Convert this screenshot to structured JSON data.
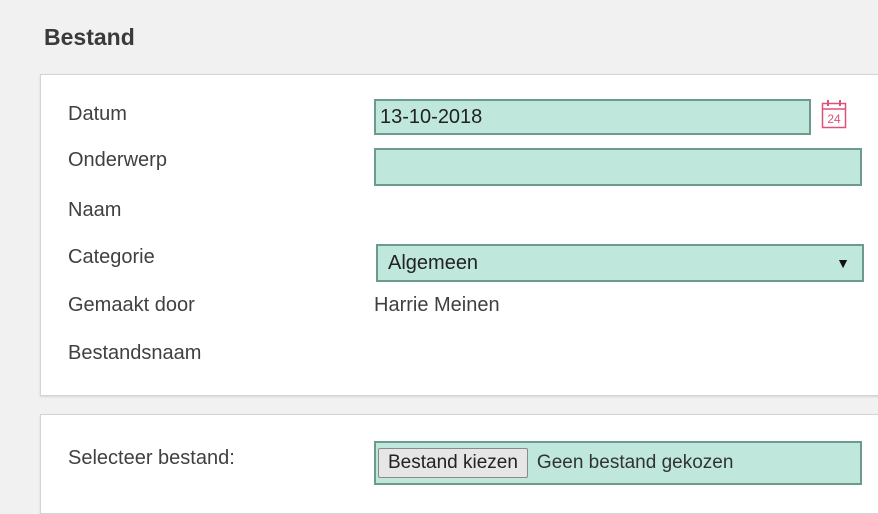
{
  "page": {
    "title": "Bestand"
  },
  "form": {
    "datum_label": "Datum",
    "datum_value": "13-10-2018",
    "calendar_day": "24",
    "onderwerp_label": "Onderwerp",
    "onderwerp_value": "",
    "naam_label": "Naam",
    "categorie_label": "Categorie",
    "categorie_value": "Algemeen",
    "gemaakt_door_label": "Gemaakt door",
    "gemaakt_door_value": "Harrie Meinen",
    "bestandsnaam_label": "Bestandsnaam"
  },
  "file": {
    "select_label": "Selecteer bestand:",
    "button_label": "Bestand kiezen",
    "status": "Geen bestand gekozen"
  },
  "icons": {
    "calendar": "calendar-icon",
    "dropdown": "chevron-down-icon"
  },
  "colors": {
    "field_bg": "#bfe7db",
    "field_border": "#6d9a8e",
    "calendar_accent": "#e0507a"
  }
}
